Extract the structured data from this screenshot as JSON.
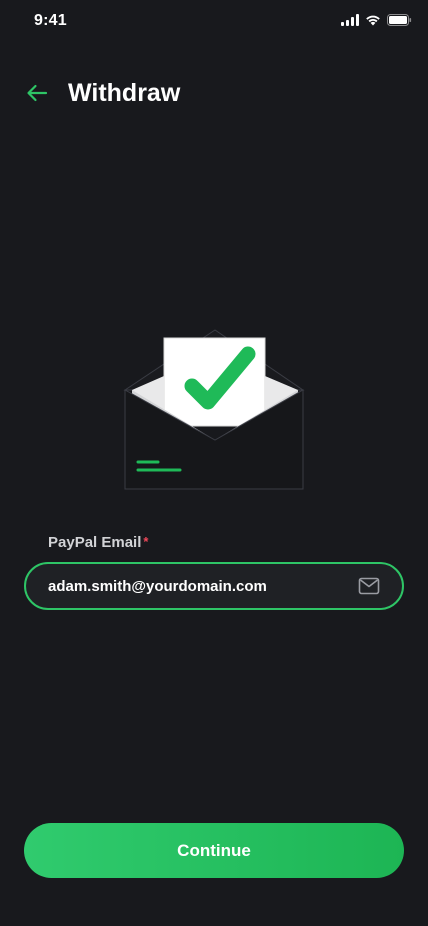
{
  "status_bar": {
    "time": "9:41",
    "icons": [
      "signal-icon",
      "wifi-icon",
      "battery-icon"
    ]
  },
  "header": {
    "back_icon": "arrow-left-icon",
    "title": "Withdraw"
  },
  "illustration": {
    "name": "envelope-checkmark-illustration"
  },
  "form": {
    "email_label": "PayPal Email",
    "required_marker": "*",
    "email_value": "adam.smith@yourdomain.com",
    "email_icon": "mail-icon"
  },
  "actions": {
    "continue_label": "Continue"
  },
  "colors": {
    "background": "#18191d",
    "accent": "#2ec566",
    "required": "#f0485a"
  }
}
